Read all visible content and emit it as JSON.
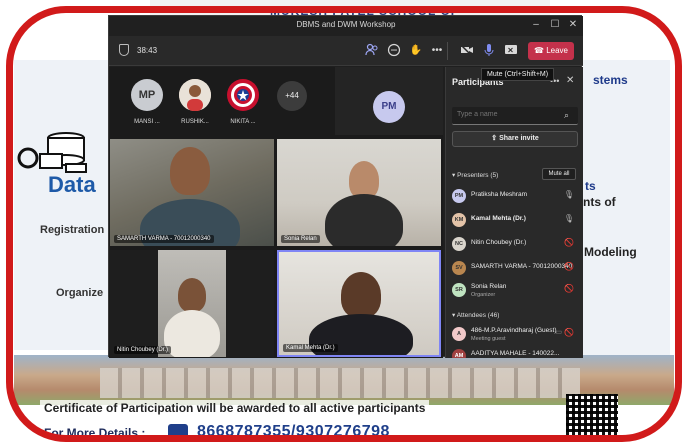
{
  "poster": {
    "header_text": "MUKESH PATEL SCHOOL OF",
    "title": "Data",
    "right_lines": [
      "stems",
      "ts",
      "nts of",
      "Modeling"
    ],
    "left_lines": [
      "Registration",
      "Organize"
    ],
    "certificate": "Certificate of Participation will be awarded to all active participants",
    "footer_label": "For More Details :",
    "phone": "8668787355/9307276798",
    "colors": {
      "frame": "#d11a1a",
      "title": "#1e5aa8",
      "phone": "#1f3f8a"
    }
  },
  "window": {
    "title": "DBMS and DWM Workshop",
    "controls": {
      "minimize": "–",
      "maximize": "☐",
      "close": "✕"
    }
  },
  "toolbar": {
    "timer": "38:43",
    "leave_label": "Leave",
    "tooltip": "Mute (Ctrl+Shift+M)",
    "icons": [
      "people-icon",
      "chat-icon",
      "raise-hand-icon",
      "more-icon",
      "camera-off-icon",
      "mic-icon",
      "share-screen-icon",
      "phone-icon"
    ]
  },
  "stage": {
    "avatars": [
      {
        "initials": "MP",
        "name": "MANSI ...",
        "color": "#c9ccd1"
      },
      {
        "initials": "",
        "name": "RUSHIK...",
        "color": "#f0d9c4"
      },
      {
        "initials": "",
        "name": "NIKITA ...",
        "color": "#2a3f8f"
      }
    ],
    "overflow": "+44",
    "pm_initials": "PM",
    "videos": [
      {
        "label": "SAMARTH VARMA - 70012000340"
      },
      {
        "label": "Sonia Relan"
      },
      {
        "label": "Nitin Choubey (Dr.)"
      },
      {
        "label": "Kamal Mehta (Dr.)"
      }
    ]
  },
  "panel": {
    "title": "Participants",
    "search_placeholder": "Type a name",
    "share_invite": "Share invite",
    "presenters_header": "Presenters (5)",
    "mute_all": "Mute all",
    "presenters": [
      {
        "initials": "PM",
        "name": "Pratiksha Meshram",
        "role": "",
        "bold": false,
        "color": "#c7c9ee",
        "mic": "on"
      },
      {
        "initials": "KM",
        "name": "Kamal Mehta (Dr.)",
        "role": "",
        "bold": true,
        "color": "#e3c3a8",
        "mic": "on"
      },
      {
        "initials": "NC",
        "name": "Nitin Choubey (Dr.)",
        "role": "",
        "bold": false,
        "color": "#d9d4cc",
        "mic": "off"
      },
      {
        "initials": "SV",
        "name": "SAMARTH VARMA - 70012000340",
        "role": "",
        "bold": false,
        "color": "#b9864f",
        "mic": "off"
      },
      {
        "initials": "SR",
        "name": "Sonia Relan",
        "role": "Organizer",
        "bold": false,
        "color": "#bfe3c0",
        "mic": "off"
      }
    ],
    "attendees_header": "Attendees (46)",
    "attendees": [
      {
        "initials": "A",
        "name": "486-M.P.Aravindharaj (Guest)",
        "role": "Meeting guest",
        "color": "#f2c9c9"
      },
      {
        "initials": "AM",
        "name": "AADITYA MAHALE - 140022...",
        "role": "",
        "color": "#a04040"
      }
    ]
  }
}
